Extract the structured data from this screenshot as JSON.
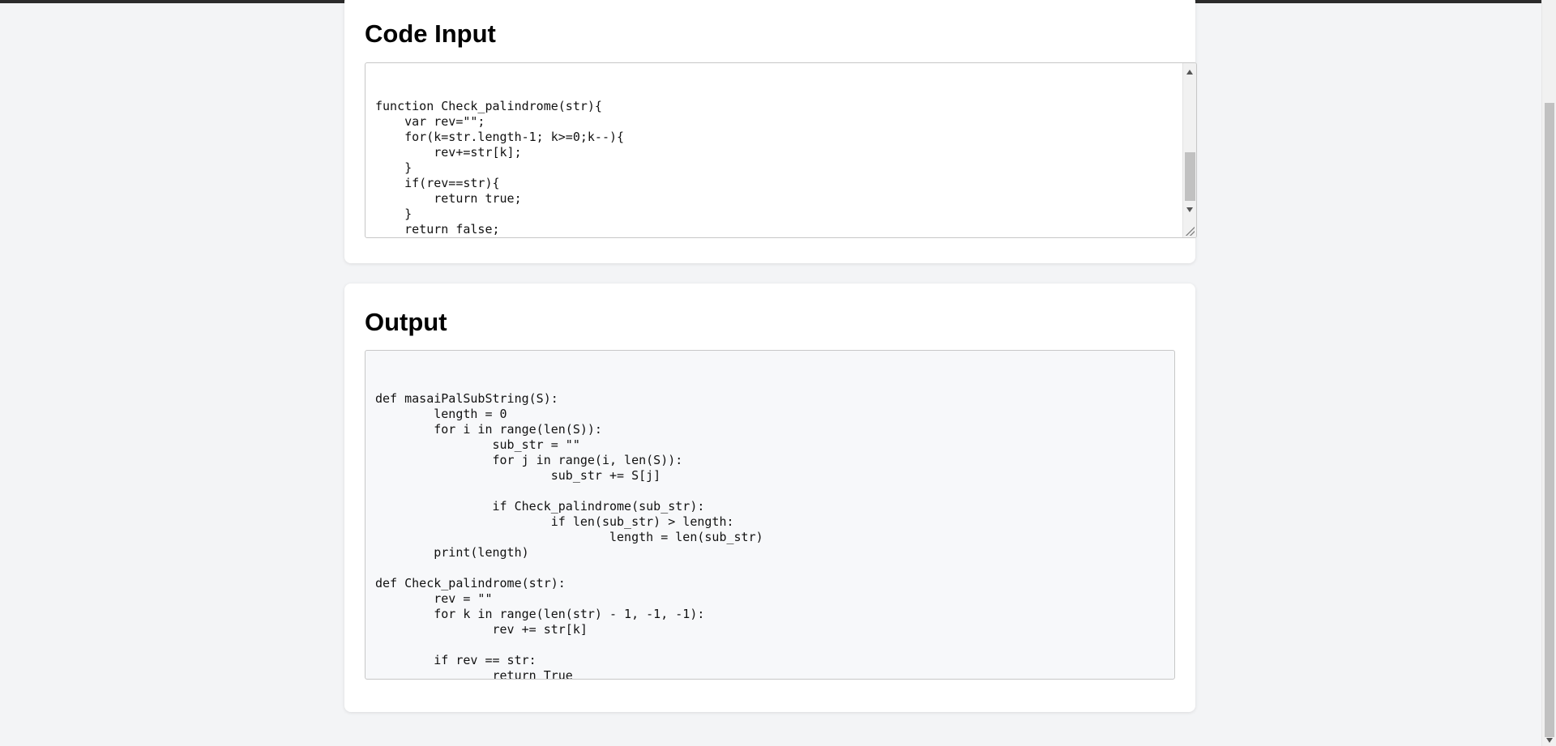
{
  "code_input": {
    "title": "Code Input",
    "value": "function Check_palindrome(str){\n    var rev=\"\";\n    for(k=str.length-1; k>=0;k--){\n        rev+=str[k];\n    }\n    if(rev==str){\n        return true;\n    }\n    return false;\n\n}"
  },
  "output": {
    "title": "Output",
    "code": "def masaiPalSubString(S):\n\tlength = 0\n\tfor i in range(len(S)):\n\t\tsub_str = \"\"\n\t\tfor j in range(i, len(S)):\n\t\t\tsub_str += S[j]\n\n\t\tif Check_palindrome(sub_str):\n\t\t\tif len(sub_str) > length:\n\t\t\t\tlength = len(sub_str)\n\tprint(length)\n\ndef Check_palindrome(str):\n\trev = \"\"\n\tfor k in range(len(str) - 1, -1, -1):\n\t\trev += str[k]\n\n\tif rev == str:\n\t\treturn True\n\treturn False"
  }
}
